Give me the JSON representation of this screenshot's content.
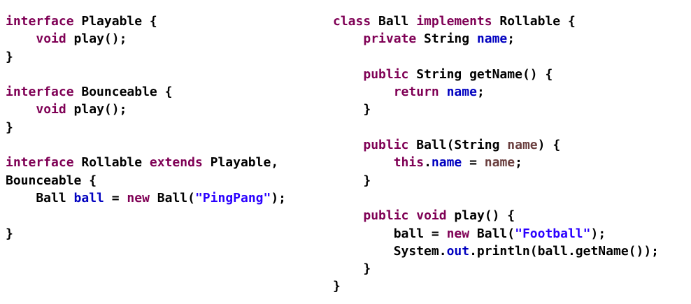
{
  "colors": {
    "keyword": "#7f0055",
    "field": "#0000c0",
    "string": "#2a00ff",
    "parameter": "#6a3e3e",
    "default": "#000000"
  },
  "left_code": [
    [
      {
        "t": "interface",
        "c": "kw"
      },
      {
        "t": " Playable {"
      }
    ],
    [
      {
        "t": "    "
      },
      {
        "t": "void",
        "c": "kw"
      },
      {
        "t": " play();"
      }
    ],
    [
      {
        "t": "}"
      }
    ],
    [],
    [
      {
        "t": "interface",
        "c": "kw"
      },
      {
        "t": " Bounceable {"
      }
    ],
    [
      {
        "t": "    "
      },
      {
        "t": "void",
        "c": "kw"
      },
      {
        "t": " play();"
      }
    ],
    [
      {
        "t": "}"
      }
    ],
    [],
    [
      {
        "t": "interface",
        "c": "kw"
      },
      {
        "t": " Rollable "
      },
      {
        "t": "extends",
        "c": "kw"
      },
      {
        "t": " Playable,"
      }
    ],
    [
      {
        "t": "Bounceable {"
      }
    ],
    [
      {
        "t": "    Ball "
      },
      {
        "t": "ball",
        "c": "fld"
      },
      {
        "t": " = "
      },
      {
        "t": "new",
        "c": "kw"
      },
      {
        "t": " Ball("
      },
      {
        "t": "\"PingPang\"",
        "c": "str"
      },
      {
        "t": ");"
      }
    ],
    [],
    [
      {
        "t": "}"
      }
    ]
  ],
  "right_code": [
    [
      {
        "t": "class",
        "c": "kw"
      },
      {
        "t": " Ball "
      },
      {
        "t": "implements",
        "c": "kw"
      },
      {
        "t": " Rollable {"
      }
    ],
    [
      {
        "t": "    "
      },
      {
        "t": "private",
        "c": "kw"
      },
      {
        "t": " String "
      },
      {
        "t": "name",
        "c": "fld"
      },
      {
        "t": ";"
      }
    ],
    [],
    [
      {
        "t": "    "
      },
      {
        "t": "public",
        "c": "kw"
      },
      {
        "t": " String getName() {"
      }
    ],
    [
      {
        "t": "        "
      },
      {
        "t": "return",
        "c": "kw"
      },
      {
        "t": " "
      },
      {
        "t": "name",
        "c": "fld"
      },
      {
        "t": ";"
      }
    ],
    [
      {
        "t": "    }"
      }
    ],
    [],
    [
      {
        "t": "    "
      },
      {
        "t": "public",
        "c": "kw"
      },
      {
        "t": " Ball(String "
      },
      {
        "t": "name",
        "c": "par"
      },
      {
        "t": ") {"
      }
    ],
    [
      {
        "t": "        "
      },
      {
        "t": "this",
        "c": "kw"
      },
      {
        "t": "."
      },
      {
        "t": "name",
        "c": "fld"
      },
      {
        "t": " = "
      },
      {
        "t": "name",
        "c": "par"
      },
      {
        "t": ";"
      }
    ],
    [
      {
        "t": "    }"
      }
    ],
    [],
    [
      {
        "t": "    "
      },
      {
        "t": "public",
        "c": "kw"
      },
      {
        "t": " "
      },
      {
        "t": "void",
        "c": "kw"
      },
      {
        "t": " play() {"
      }
    ],
    [
      {
        "t": "        ball = "
      },
      {
        "t": "new",
        "c": "kw"
      },
      {
        "t": " Ball("
      },
      {
        "t": "\"Football\"",
        "c": "str"
      },
      {
        "t": ");"
      }
    ],
    [
      {
        "t": "        System."
      },
      {
        "t": "out",
        "c": "fld"
      },
      {
        "t": ".println(ball.getName());"
      }
    ],
    [
      {
        "t": "    }"
      }
    ],
    [
      {
        "t": "}"
      }
    ]
  ]
}
